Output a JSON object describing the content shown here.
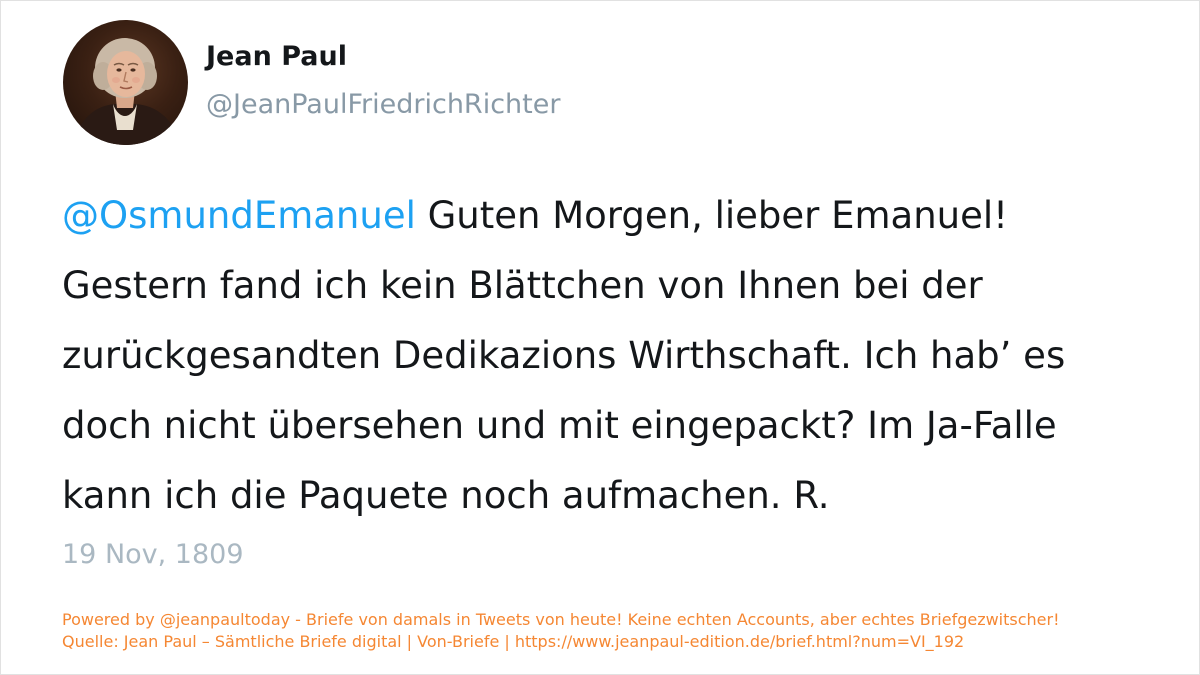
{
  "author": {
    "name": "Jean Paul",
    "handle": "@JeanPaulFriedrichRichter",
    "avatar_icon": "portrait-avatar"
  },
  "tweet": {
    "mention": "@OsmundEmanuel",
    "text": " Guten Morgen, lieber Emanuel!\nGestern fand ich kein Blättchen von Ihnen bei der\nzurückgesandten Dedikazions Wirthschaft. Ich hab’ es\ndoch nicht übersehen und mit eingepackt? Im Ja-Falle\nkann ich die Paquete noch aufmachen. R.",
    "date": "19 Nov, 1809"
  },
  "footer": {
    "line1": "Powered by @jeanpaultoday - Briefe von damals in Tweets von heute! Keine echten Accounts, aber echtes Briefgezwitscher!",
    "line2": "Quelle: Jean Paul – Sämtliche Briefe digital | Von-Briefe | https://www.jeanpaul-edition.de/brief.html?num=VI_192"
  },
  "colors": {
    "mention": "#1da1f2",
    "text": "#14171a",
    "muted": "#aab8c2",
    "footer": "#f58733"
  }
}
